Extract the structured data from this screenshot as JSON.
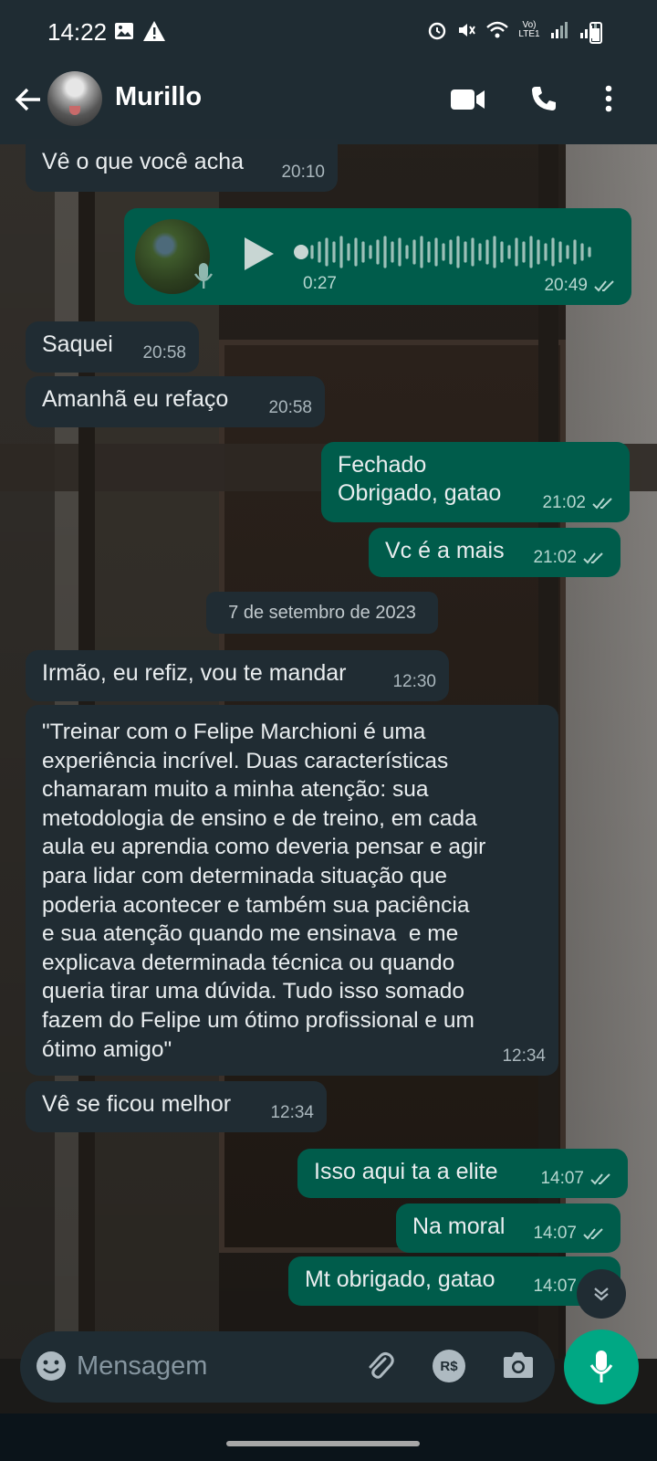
{
  "status_bar": {
    "time": "14:22",
    "network": "Vo) LTE1"
  },
  "header": {
    "contact_name": "Murillo"
  },
  "messages": [
    {
      "dir": "in",
      "text": "Vê o que você acha",
      "time": "20:10"
    },
    {
      "dir": "out",
      "type": "voice",
      "duration": "0:27",
      "time": "20:49",
      "read": true
    },
    {
      "dir": "in",
      "text": "Saquei",
      "time": "20:58"
    },
    {
      "dir": "in",
      "text": "Amanhã eu refaço",
      "time": "20:58"
    },
    {
      "dir": "out",
      "text": "Fechado\nObrigado, gatao",
      "time": "21:02",
      "read": true
    },
    {
      "dir": "out",
      "text": "Vc é a mais",
      "time": "21:02",
      "read": true
    },
    {
      "dir": "in",
      "text": "Irmão, eu refiz, vou te mandar",
      "time": "12:30"
    },
    {
      "dir": "in",
      "text": "\"Treinar com o Felipe Marchioni é uma\nexperiência incrível. Duas características\nchamaram muito a minha atenção: sua\nmetodologia de ensino e de treino, em cada\naula eu aprendia como deveria pensar e agir\npara lidar com determinada situação que\npoderia acontecer e também sua paciência\ne sua atenção quando me ensinava  e me\nexplicava determinada técnica ou quando\nqueria tirar uma dúvida. Tudo isso somado\nfazem do Felipe um ótimo profissional e um\nótimo amigo\"",
      "time": "12:34"
    },
    {
      "dir": "in",
      "text": "Vê se ficou melhor",
      "time": "12:34"
    },
    {
      "dir": "out",
      "text": "Isso aqui ta a elite",
      "time": "14:07",
      "read": true
    },
    {
      "dir": "out",
      "text": "Na moral",
      "time": "14:07",
      "read": true
    },
    {
      "dir": "out",
      "text": "Mt obrigado, gatao",
      "time": "14:07",
      "read": true
    }
  ],
  "date_separator": "7 de setembro de 2023",
  "composer": {
    "placeholder": "Mensagem",
    "payment_label": "R$"
  },
  "colors": {
    "bar": "#1f2c33",
    "incoming": "#202c33",
    "outgoing": "#005c4b",
    "accent": "#00a884"
  },
  "icons": [
    "back-arrow-icon",
    "video-call-icon",
    "phone-icon",
    "more-options-icon",
    "emoji-icon",
    "attach-icon",
    "camera-icon",
    "mic-icon",
    "play-icon",
    "chevron-down-icon",
    "double-check-icon"
  ]
}
